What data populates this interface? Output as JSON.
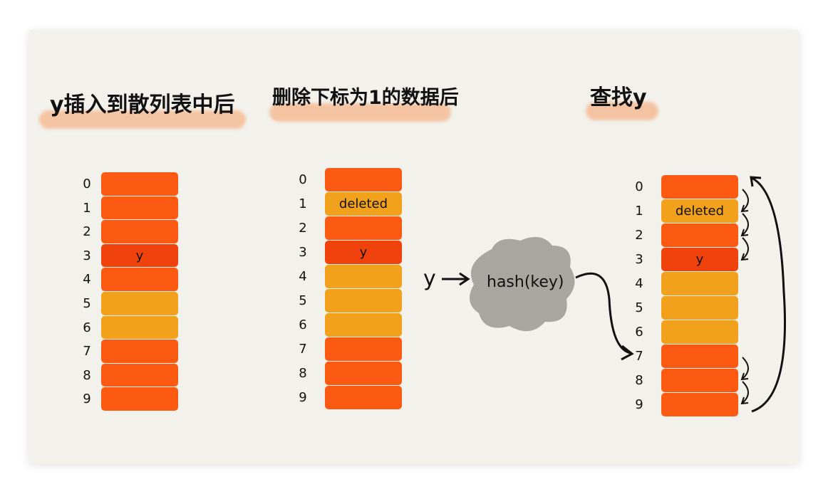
{
  "colors": {
    "red": "#fc5a12",
    "dark": "#f0420c",
    "yellow": "#f2a11d",
    "background": "#f2f1ec"
  },
  "panels": [
    {
      "title": "y插入到散列表中后",
      "cells": [
        {
          "i": "0",
          "t": "red",
          "l": ""
        },
        {
          "i": "1",
          "t": "red",
          "l": ""
        },
        {
          "i": "2",
          "t": "red",
          "l": ""
        },
        {
          "i": "3",
          "t": "dark",
          "l": "y"
        },
        {
          "i": "4",
          "t": "red",
          "l": ""
        },
        {
          "i": "5",
          "t": "yellow",
          "l": ""
        },
        {
          "i": "6",
          "t": "yellow",
          "l": ""
        },
        {
          "i": "7",
          "t": "red",
          "l": ""
        },
        {
          "i": "8",
          "t": "red",
          "l": ""
        },
        {
          "i": "9",
          "t": "red",
          "l": ""
        }
      ]
    },
    {
      "title": "删除下标为1的数据后",
      "cells": [
        {
          "i": "0",
          "t": "red",
          "l": ""
        },
        {
          "i": "1",
          "t": "yellow",
          "l": "deleted"
        },
        {
          "i": "2",
          "t": "red",
          "l": ""
        },
        {
          "i": "3",
          "t": "dark",
          "l": "y"
        },
        {
          "i": "4",
          "t": "yellow",
          "l": ""
        },
        {
          "i": "5",
          "t": "yellow",
          "l": ""
        },
        {
          "i": "6",
          "t": "yellow",
          "l": ""
        },
        {
          "i": "7",
          "t": "red",
          "l": ""
        },
        {
          "i": "8",
          "t": "red",
          "l": ""
        },
        {
          "i": "9",
          "t": "red",
          "l": ""
        }
      ]
    },
    {
      "title": "查找y",
      "cells": [
        {
          "i": "0",
          "t": "red",
          "l": ""
        },
        {
          "i": "1",
          "t": "yellow",
          "l": "deleted"
        },
        {
          "i": "2",
          "t": "red",
          "l": ""
        },
        {
          "i": "3",
          "t": "dark",
          "l": "y"
        },
        {
          "i": "4",
          "t": "yellow",
          "l": ""
        },
        {
          "i": "5",
          "t": "yellow",
          "l": ""
        },
        {
          "i": "6",
          "t": "yellow",
          "l": ""
        },
        {
          "i": "7",
          "t": "red",
          "l": ""
        },
        {
          "i": "8",
          "t": "red",
          "l": ""
        },
        {
          "i": "9",
          "t": "red",
          "l": ""
        }
      ]
    }
  ],
  "lookup": {
    "key": "y",
    "function": "hash(key)"
  }
}
